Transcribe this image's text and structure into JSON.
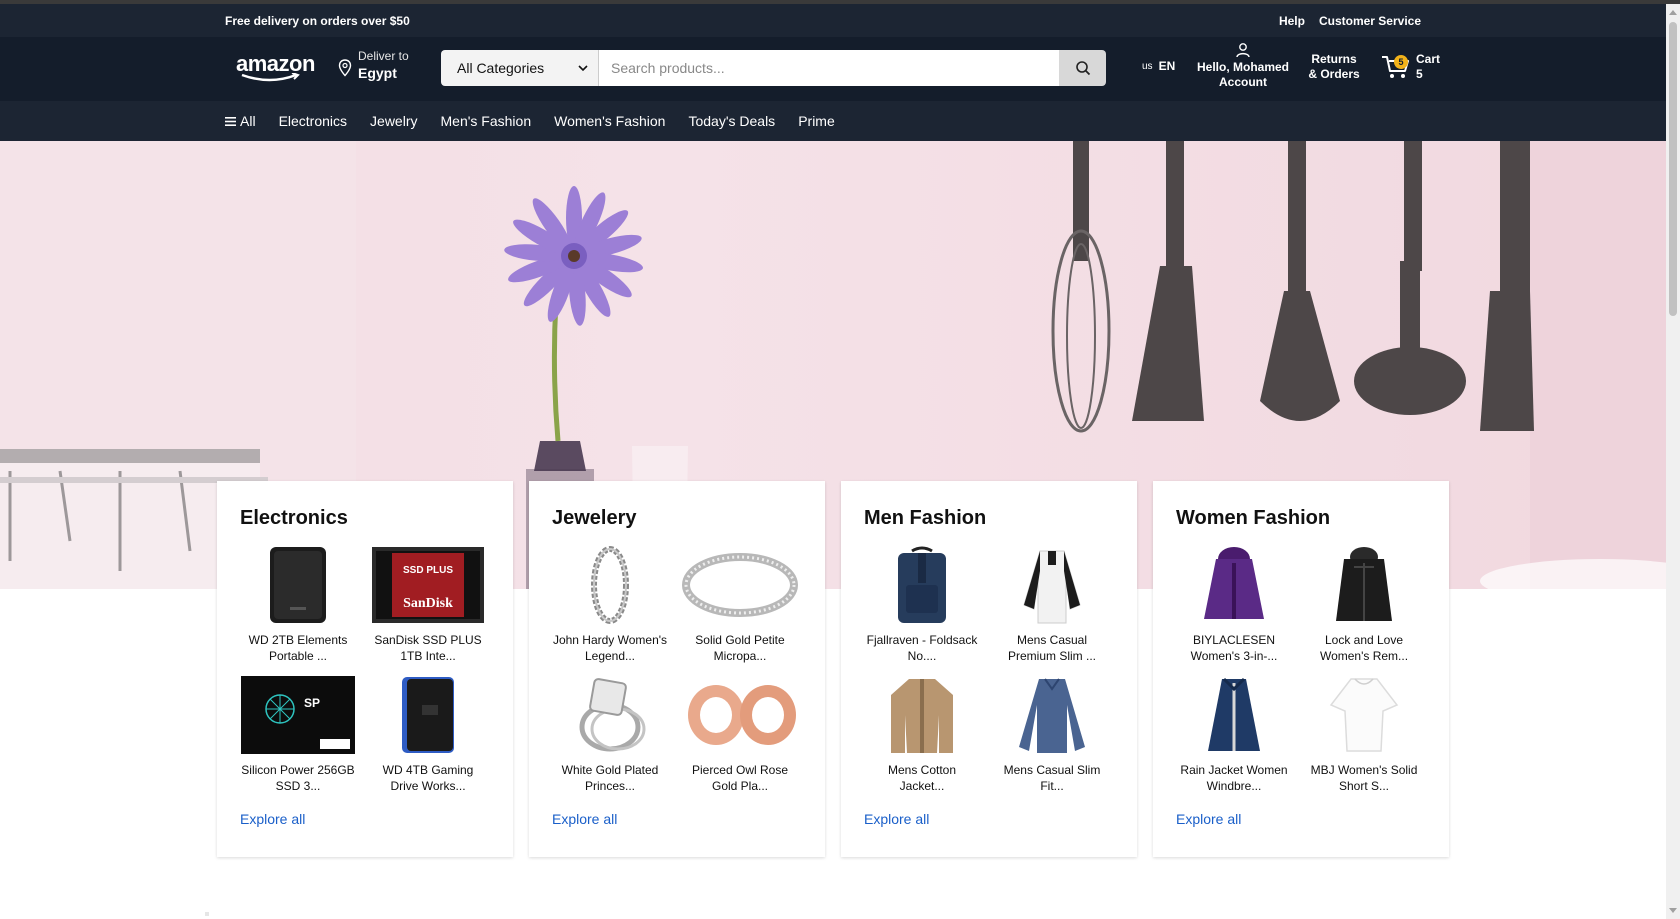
{
  "promo": {
    "left": "Free delivery on orders over $50",
    "help": "Help",
    "customer_service": "Customer Service"
  },
  "header": {
    "logo": "amazon",
    "deliver_label": "Deliver to",
    "deliver_country": "Egypt",
    "category_selected": "All Categories",
    "search_placeholder": "Search products...",
    "flag": "us",
    "language": "EN",
    "account_line1": "Hello, Mohamed",
    "account_line2": "Account",
    "returns_line1": "Returns",
    "returns_line2": "& Orders",
    "cart_label": "Cart",
    "cart_count": "5",
    "cart_badge": "5"
  },
  "nav": {
    "all": "All",
    "items": [
      "Electronics",
      "Jewelry",
      "Men's Fashion",
      "Women's Fashion",
      "Today's Deals",
      "Prime"
    ]
  },
  "colors": {
    "header_bg": "#141d2b",
    "nav_bg": "#1c2533",
    "link": "#1a5fc9",
    "badge": "#f2b21a"
  },
  "cards": [
    {
      "title": "Electronics",
      "explore": "Explore all",
      "items": [
        {
          "name": "WD 2TB Elements Portable ...",
          "icon": "external-hdd"
        },
        {
          "name": "SanDisk SSD PLUS 1TB Inte...",
          "icon": "ssd-sandisk"
        },
        {
          "name": "Silicon Power 256GB SSD 3...",
          "icon": "ssd-silicon-power"
        },
        {
          "name": "WD 4TB Gaming Drive Works...",
          "icon": "gaming-drive"
        }
      ]
    },
    {
      "title": "Jewelery",
      "explore": "Explore all",
      "items": [
        {
          "name": "John Hardy Women's Legend...",
          "icon": "chain-bracelet"
        },
        {
          "name": "Solid Gold Petite Micropa...",
          "icon": "silver-ring"
        },
        {
          "name": "White Gold Plated Princes...",
          "icon": "diamond-ring"
        },
        {
          "name": "Pierced Owl Rose Gold Pla...",
          "icon": "rose-gold-tunnels"
        }
      ]
    },
    {
      "title": "Men Fashion",
      "explore": "Explore all",
      "items": [
        {
          "name": "Fjallraven - Foldsack No....",
          "icon": "backpack"
        },
        {
          "name": "Mens Casual Premium Slim ...",
          "icon": "raglan-tshirt"
        },
        {
          "name": "Mens Cotton Jacket...",
          "icon": "cotton-jacket"
        },
        {
          "name": "Mens Casual Slim Fit...",
          "icon": "long-sleeve-shirt"
        }
      ]
    },
    {
      "title": "Women Fashion",
      "explore": "Explore all",
      "items": [
        {
          "name": "BIYLACLESEN Women's 3-in-...",
          "icon": "purple-jacket"
        },
        {
          "name": "Lock and Love Women's Rem...",
          "icon": "leather-jacket"
        },
        {
          "name": "Rain Jacket Women Windbre...",
          "icon": "rain-coat"
        },
        {
          "name": "MBJ Women's Solid Short S...",
          "icon": "white-top"
        }
      ]
    }
  ]
}
